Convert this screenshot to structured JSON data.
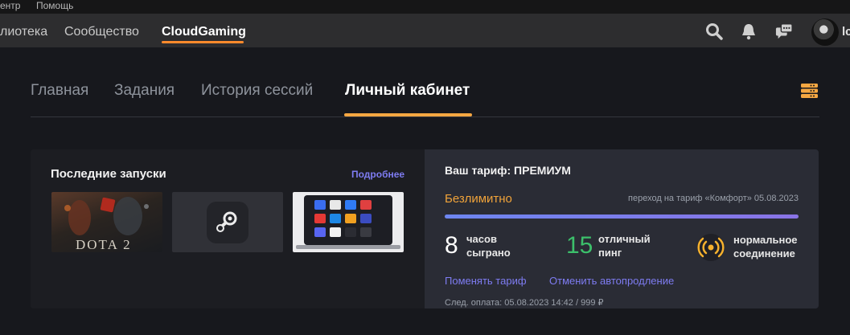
{
  "menubar": {
    "item1": "ентр",
    "item2": "Помощь"
  },
  "topnav": {
    "items": [
      "лиотека",
      "Сообщество",
      "CloudGaming"
    ],
    "active_index": 2,
    "accent": "#ff8a2c",
    "icons": [
      "search-icon",
      "bell-icon",
      "chat-icon"
    ],
    "user_initial": "lc"
  },
  "tabs": {
    "items": [
      "Главная",
      "Задания",
      "История сессий",
      "Личный кабинет"
    ],
    "active_index": 3,
    "menu_icon": "server-list-icon"
  },
  "recent": {
    "title": "Последние запуски",
    "more_link": "Подробнее",
    "thumbs": [
      {
        "name": "dota2-thumb",
        "label": "DOTA 2"
      },
      {
        "name": "steam-thumb",
        "label": ""
      },
      {
        "name": "apps-thumb",
        "label": ""
      }
    ]
  },
  "tariff": {
    "title": "Ваш тариф: ПРЕМИУМ",
    "plan_label": "Безлимитно",
    "transition_note": "переход на тариф «Комфорт» 05.08.2023",
    "progress_fraction": 1.0,
    "plan_color": "#f0a33a"
  },
  "stats": {
    "hours_value": "8",
    "hours_line1": "часов",
    "hours_line2": "сыграно",
    "ping_value": "15",
    "ping_line1": "отличный",
    "ping_line2": "пинг",
    "ping_color": "#3cc06b",
    "conn_line1": "нормальное",
    "conn_line2": "соединение",
    "conn_icon": "signal-icon",
    "conn_color": "#f5b12e"
  },
  "actions": {
    "change_tariff": "Поменять тариф",
    "cancel_autorenew": "Отменить автопродление"
  },
  "next_payment": "След. оплата: 05.08.2023 14:42 / 999 ₽"
}
